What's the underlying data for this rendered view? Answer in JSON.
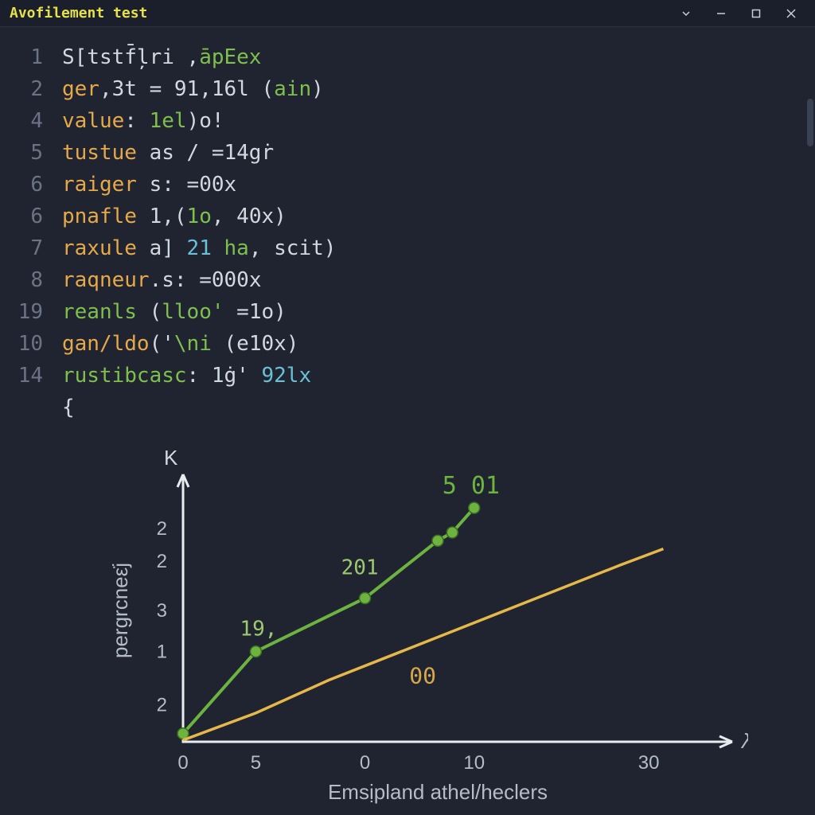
{
  "window": {
    "title": "Avofilement test"
  },
  "code": {
    "lines": [
      {
        "n": "1",
        "tokens": [
          [
            "S[tstf̄l̦ri ,",
            "plain"
          ],
          [
            "āpEex",
            "green"
          ]
        ]
      },
      {
        "n": "2",
        "tokens": [
          [
            "ger",
            "key"
          ],
          [
            ",3t = ",
            "plain"
          ],
          [
            "91",
            "num"
          ],
          [
            ",",
            "plain"
          ],
          [
            "16l",
            "num"
          ],
          [
            " (",
            "plain"
          ],
          [
            "ain",
            "green"
          ],
          [
            ")",
            "plain"
          ]
        ]
      },
      {
        "n": "4",
        "tokens": [
          [
            "value",
            "key"
          ],
          [
            ": ",
            "plain"
          ],
          [
            "1el",
            "green"
          ],
          [
            ")o!",
            "plain"
          ]
        ]
      },
      {
        "n": "5",
        "tokens": [
          [
            "tustue",
            "key"
          ],
          [
            " as / =",
            "plain"
          ],
          [
            "14gṙ",
            "num"
          ]
        ]
      },
      {
        "n": "6",
        "tokens": [
          [
            "raiger",
            "key"
          ],
          [
            " s: =",
            "plain"
          ],
          [
            "00x",
            "num"
          ]
        ]
      },
      {
        "n": "6",
        "tokens": [
          [
            "pnafle",
            "key"
          ],
          [
            " 1,(",
            "plain"
          ],
          [
            "1o",
            "green"
          ],
          [
            ", ",
            "plain"
          ],
          [
            "40x",
            "num"
          ],
          [
            ")",
            "plain"
          ]
        ]
      },
      {
        "n": "7",
        "tokens": [
          [
            "raxule",
            "key"
          ],
          [
            " a] ",
            "plain"
          ],
          [
            "21",
            "cyan"
          ],
          [
            " ",
            "plain"
          ],
          [
            "ha",
            "green"
          ],
          [
            ", scit)",
            "plain"
          ]
        ]
      },
      {
        "n": "8",
        "tokens": [
          [
            "raqneur",
            "key"
          ],
          [
            ".s: =",
            "plain"
          ],
          [
            "000x",
            "num"
          ]
        ]
      },
      {
        "n": "19",
        "tokens": [
          [
            "reanls",
            "green"
          ],
          [
            " (",
            "plain"
          ],
          [
            "lloo'",
            "green"
          ],
          [
            " =",
            "plain"
          ],
          [
            "1o",
            "num"
          ],
          [
            ")",
            "plain"
          ]
        ]
      },
      {
        "n": "10",
        "tokens": [
          [
            "gan/ldo",
            "key"
          ],
          [
            "('",
            "plain"
          ],
          [
            "\\ni",
            "green"
          ],
          [
            " (",
            "plain"
          ],
          [
            "e10x",
            "num"
          ],
          [
            ")",
            "plain"
          ]
        ]
      },
      {
        "n": "14",
        "tokens": [
          [
            "rustibcasc",
            "green"
          ],
          [
            ": ",
            "plain"
          ],
          [
            "1ġ' ",
            "num"
          ],
          [
            "92lx",
            "cyan"
          ]
        ]
      },
      {
        "n": "",
        "tokens": [
          [
            "{",
            "plain"
          ]
        ]
      }
    ]
  },
  "chart_data": {
    "type": "line",
    "title": "K",
    "xlabel": "Emsịpland athel/heclers",
    "ylabel": "pergrcneε̇j",
    "xlim": [
      0,
      35
    ],
    "ylim": [
      0,
      3.2
    ],
    "x_ticks": [
      "0",
      "5",
      "0",
      "10",
      "30"
    ],
    "x_tick_positions": [
      0,
      5,
      12.5,
      20,
      32
    ],
    "y_ticks": [
      "2",
      "2",
      "3",
      "1",
      "2"
    ],
    "y_tick_positions": [
      2.6,
      2.2,
      1.6,
      1.1,
      0.45
    ],
    "axis_end_label": "λ",
    "series": [
      {
        "name": "green",
        "color": "#6db33f",
        "has_markers": true,
        "x": [
          0,
          5,
          12.5,
          17.5,
          18.5,
          20
        ],
        "y": [
          0.1,
          1.1,
          1.75,
          2.45,
          2.55,
          2.85
        ],
        "point_labels": [
          null,
          "19,",
          "201",
          null,
          null,
          "5  01"
        ]
      },
      {
        "name": "yellow",
        "color": "#e6b84a",
        "has_markers": false,
        "x": [
          0,
          5,
          10,
          15,
          20,
          25,
          30,
          33
        ],
        "y": [
          0.02,
          0.35,
          0.75,
          1.1,
          1.45,
          1.8,
          2.15,
          2.35
        ],
        "point_labels": [
          null,
          null,
          null,
          "00",
          null,
          null,
          null,
          null
        ]
      }
    ]
  }
}
